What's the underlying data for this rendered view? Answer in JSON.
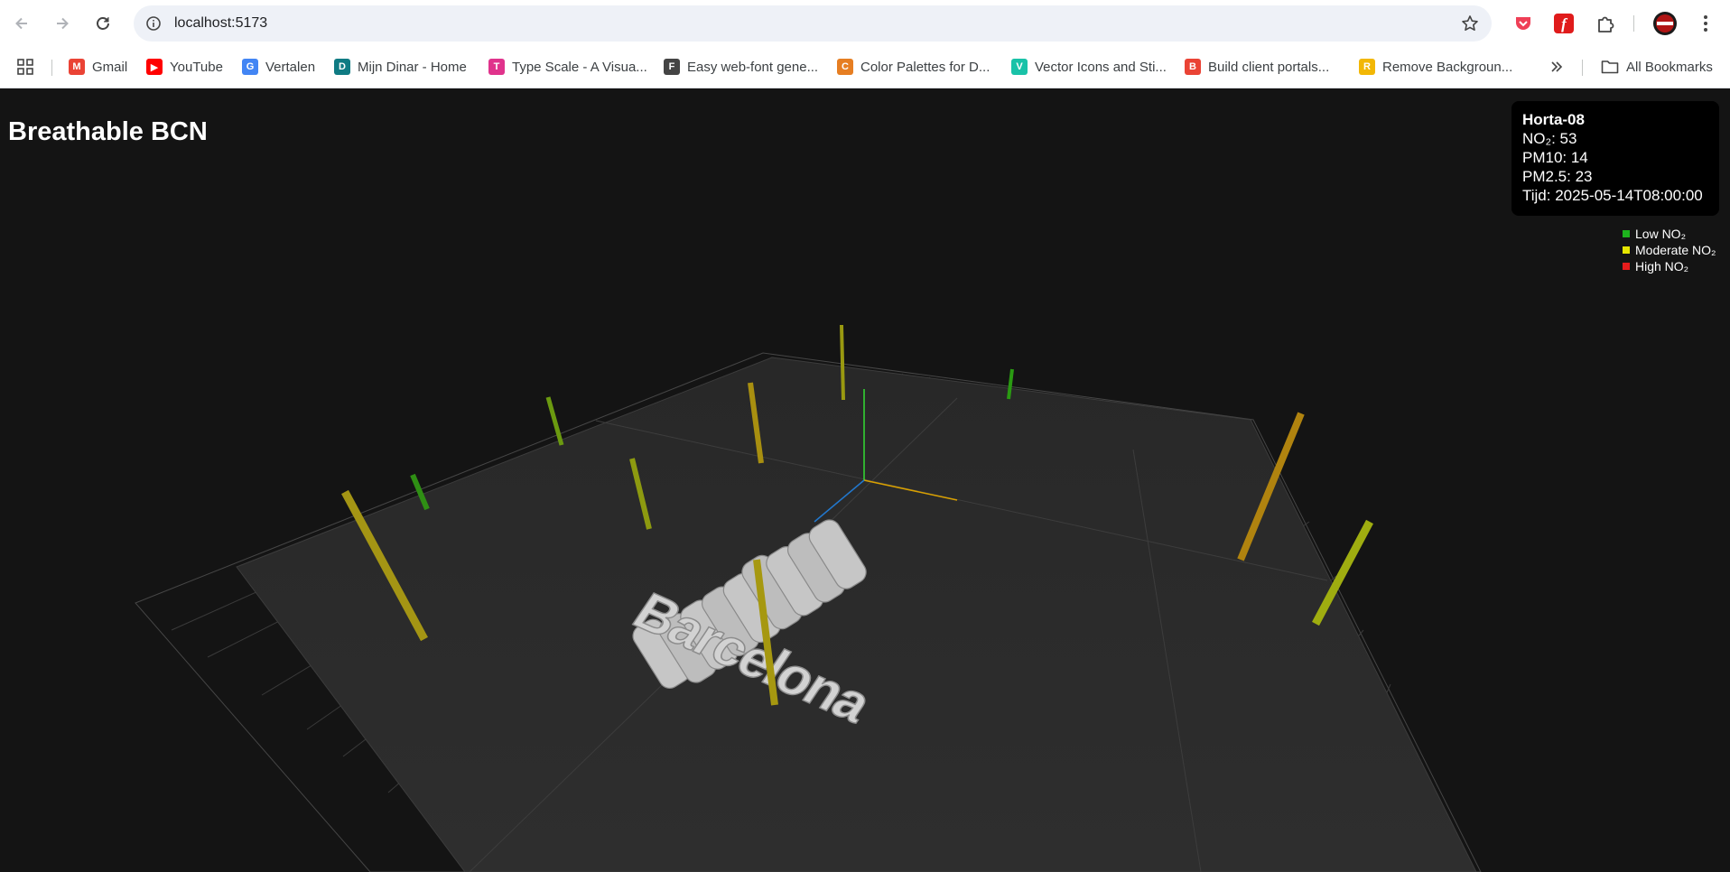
{
  "browser": {
    "url": "localhost:5173",
    "bookmarks": [
      {
        "label": "Gmail",
        "icon": "gmail-icon",
        "color": "#ea4335"
      },
      {
        "label": "YouTube",
        "icon": "youtube-icon",
        "color": "#ff0000"
      },
      {
        "label": "Vertalen",
        "icon": "translate-icon",
        "color": "#4285f4"
      },
      {
        "label": "Mijn Dinar - Home",
        "icon": "dinar-icon",
        "color": "#0f7b83"
      },
      {
        "label": "Type Scale - A Visua...",
        "icon": "typescale-icon",
        "color": "#e0338c"
      },
      {
        "label": "Easy web-font gene...",
        "icon": "fontgen-icon",
        "color": "#444444"
      },
      {
        "label": "Color Palettes for D...",
        "icon": "palette-icon",
        "color": "#e67e22"
      },
      {
        "label": "Vector Icons and Sti...",
        "icon": "vector-icon",
        "color": "#19c2a8"
      },
      {
        "label": "Build client portals...",
        "icon": "portals-icon",
        "color": "#ea4335"
      },
      {
        "label": "Remove Backgroun...",
        "icon": "removebg-icon",
        "color": "#f2b705"
      }
    ],
    "all_bookmarks_label": "All Bookmarks"
  },
  "app": {
    "title": "Breathable BCN",
    "model_text": "Barcelona",
    "info": {
      "station": "Horta-08",
      "no2": "NO₂: 53",
      "pm10": "PM10: 14",
      "pm25": "PM2.5: 23",
      "time": "Tijd: 2025-05-14T08:00:00"
    },
    "legend": [
      {
        "label": "Low NO₂",
        "color": "#1db31d"
      },
      {
        "label": "Moderate NO₂",
        "color": "#e6e600"
      },
      {
        "label": "High NO₂",
        "color": "#e61c1c"
      }
    ]
  }
}
